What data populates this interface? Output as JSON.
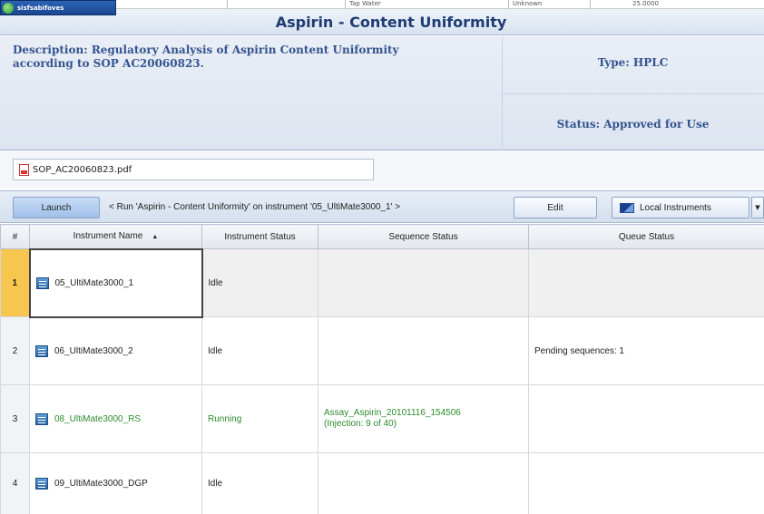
{
  "top_strip": {
    "cells": [
      "Tap Water",
      "Unknown",
      "25.0000"
    ]
  },
  "logo": {
    "text": "sisfsabifoves"
  },
  "title": "Aspirin - Content Uniformity",
  "description": {
    "text_line1": "Description: Regulatory Analysis of Aspirin Content Uniformity",
    "text_line2": "according to SOP AC20060823.",
    "type": "Type: HPLC",
    "status": "Status: Approved for Use"
  },
  "attachment": {
    "filename": "SOP_AC20060823.pdf",
    "icon": "pdf-icon"
  },
  "toolbar": {
    "launch_label": "Launch",
    "run_text": "< Run 'Aspirin - Content Uniformity' on instrument '05_UltiMate3000_1' >",
    "edit_label": "Edit",
    "instruments_label": "Local Instruments"
  },
  "grid": {
    "headers": [
      "#",
      "Instrument Name",
      "Instrument Status",
      "Sequence Status",
      "Queue Status"
    ],
    "rows": [
      {
        "num": "1",
        "name": "05_UltiMate3000_1",
        "status": "Idle",
        "sequence_line1": "",
        "sequence_line2": "",
        "queue": ""
      },
      {
        "num": "2",
        "name": "06_UltiMate3000_2",
        "status": "Idle",
        "sequence_line1": "",
        "sequence_line2": "",
        "queue": "Pending sequences: 1"
      },
      {
        "num": "3",
        "name": "08_UltiMate3000_RS",
        "status": "Running",
        "sequence_line1": "Assay_Aspirin_20101116_154506",
        "sequence_line2": "(Injection: 9 of 40)",
        "queue": ""
      },
      {
        "num": "4",
        "name": "09_UltiMate3000_DGP",
        "status": "Idle",
        "sequence_line1": "",
        "sequence_line2": "",
        "queue": ""
      }
    ]
  }
}
